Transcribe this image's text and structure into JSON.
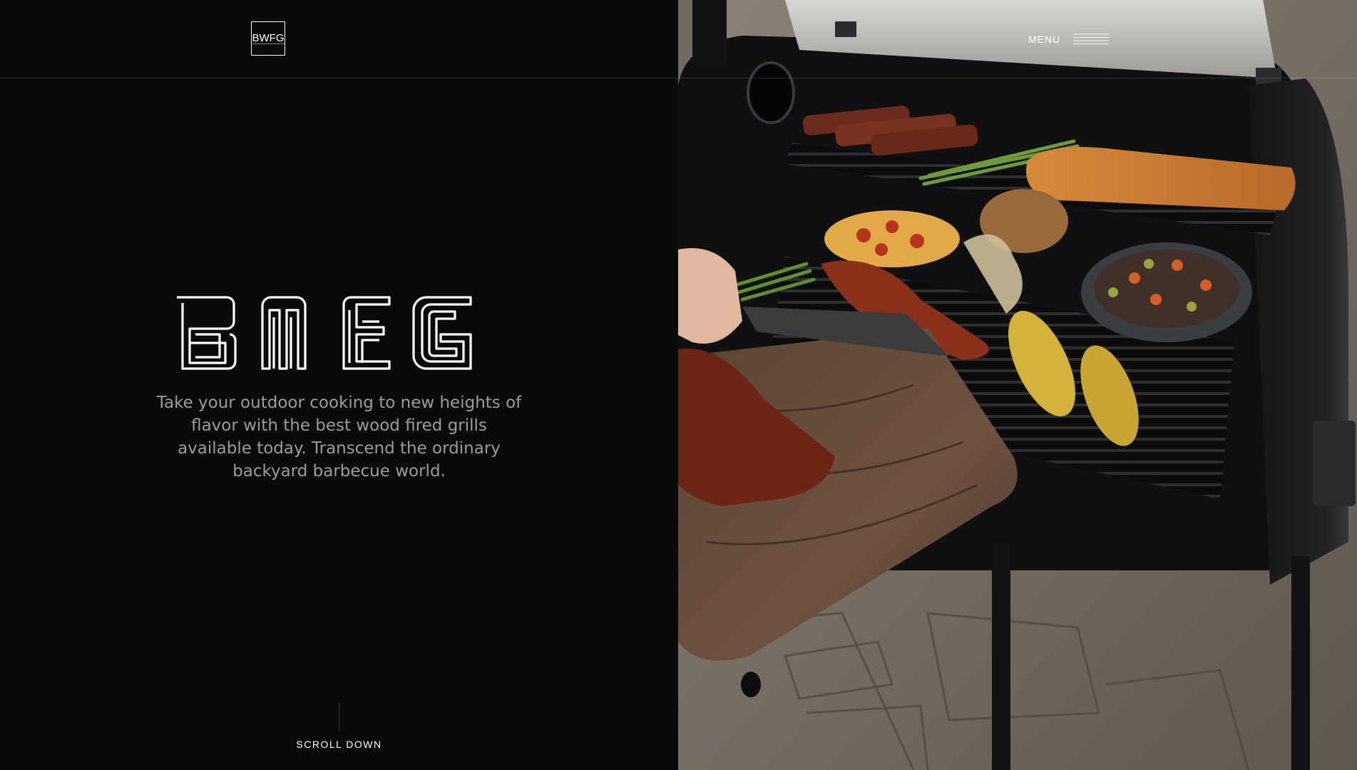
{
  "header": {
    "logo_text": "BWFG",
    "menu_label": "MENU"
  },
  "hero": {
    "wordmark": "BWFG",
    "tagline": "Take your outdoor cooking to new heights of flavor with the best wood fired grills available today. Transcend the ordinary backyard barbecue world."
  },
  "scroll": {
    "label": "SCROLL DOWN"
  },
  "colors": {
    "background": "#0a0a0b",
    "text": "#ffffff",
    "tagline": "#9c9c9c"
  },
  "icons": {
    "menu": "hamburger-icon"
  }
}
